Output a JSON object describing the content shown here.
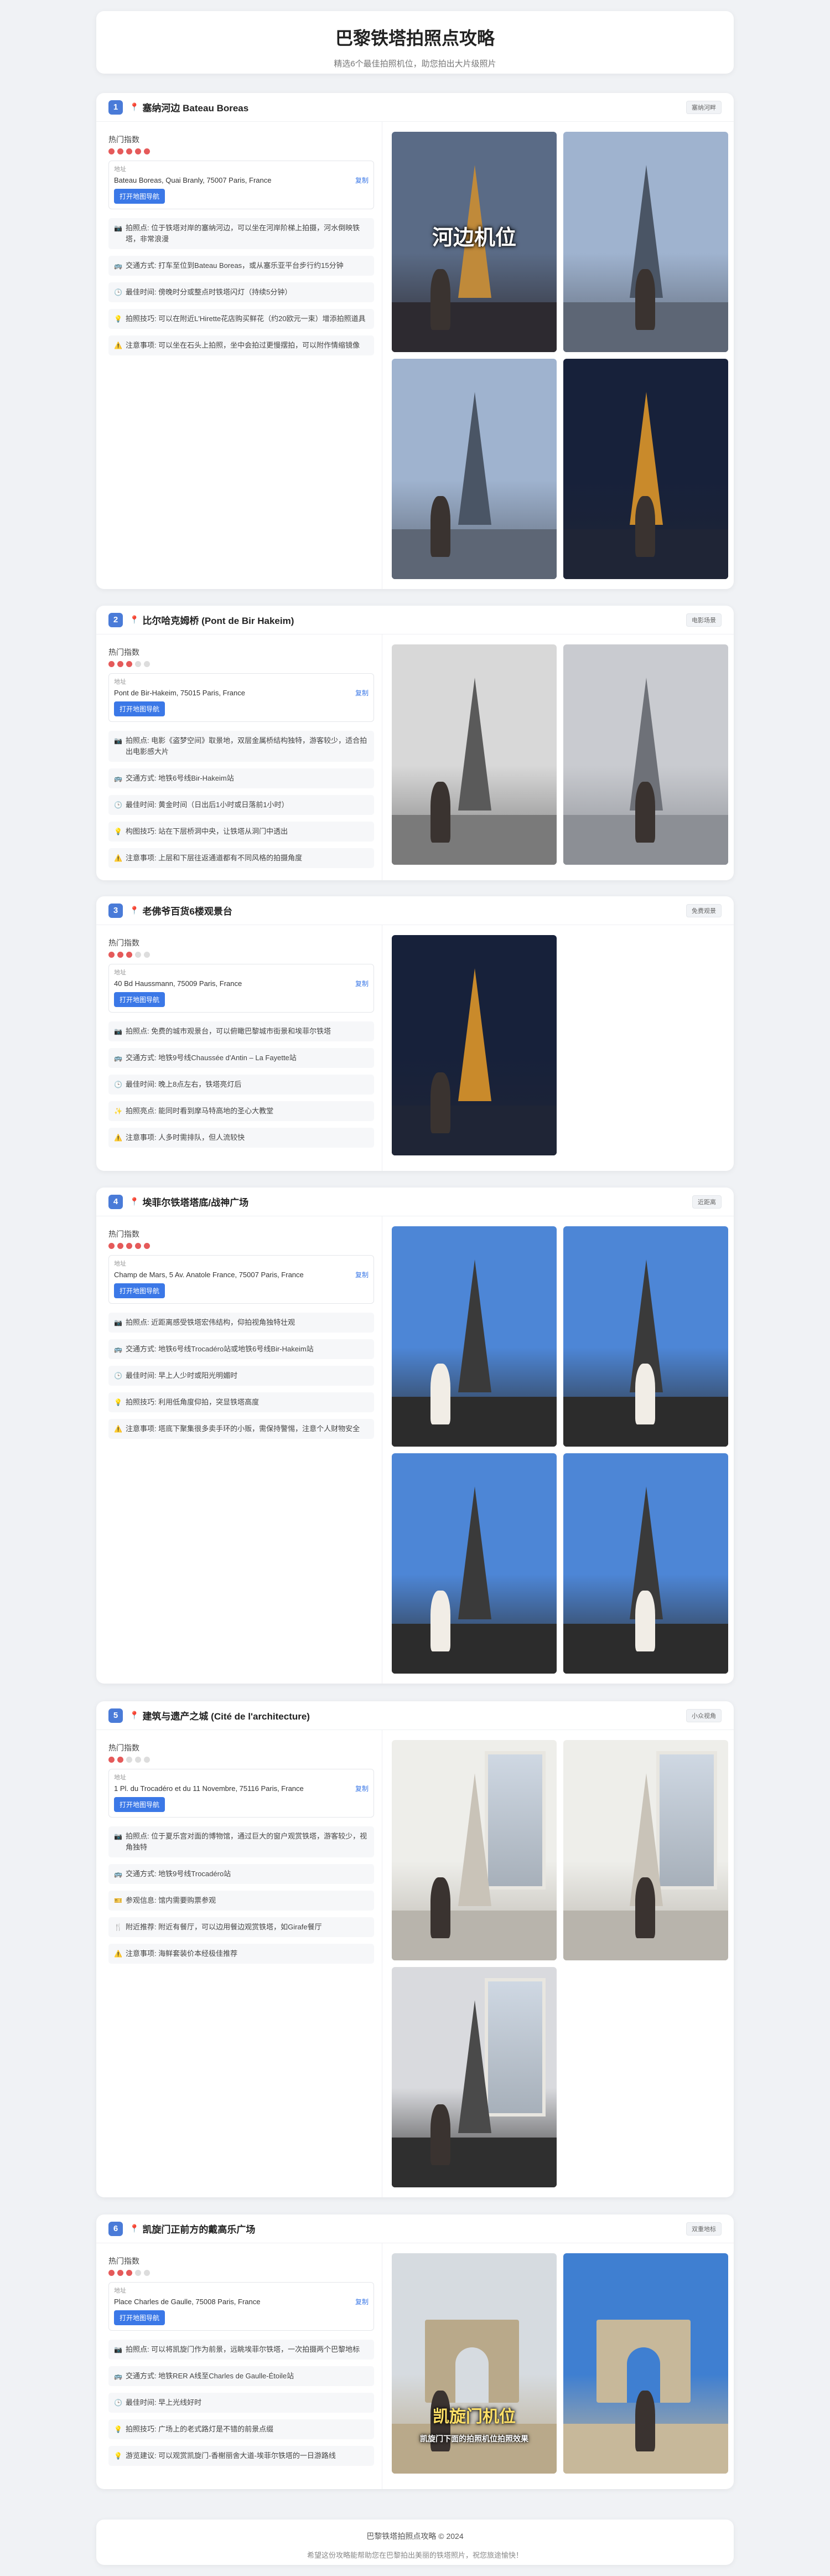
{
  "header": {
    "title": "巴黎铁塔拍照点攻略",
    "subtitle": "精选6个最佳拍照机位，助您拍出大片级照片"
  },
  "common": {
    "popularity_label": "热门指数",
    "address_label": "地址",
    "copy_label": "复制",
    "nav_label": "打开地图导航"
  },
  "sections": [
    {
      "num": "1",
      "title": "塞纳河边 Bateau Boreas",
      "tag": "塞纳河畔",
      "rating": 5,
      "address": "Bateau Boreas, Quai Branly, 75007 Paris, France",
      "tips": [
        {
          "icon": "camera-icon",
          "text": "拍照点: 位于铁塔对岸的塞纳河边，可以坐在河岸阶梯上拍摄，河水倒映铁塔，非常浪漫"
        },
        {
          "icon": "bus-icon",
          "text": "交通方式: 打车至位到Bateau Boreas，或从塞乐亚平台步行约15分钟"
        },
        {
          "icon": "clock-icon",
          "text": "最佳时间: 傍晚时分或整点时铁塔闪灯（持续5分钟）"
        },
        {
          "icon": "bulb-icon",
          "text": "拍照技巧: 可以在附近L'Hirette花店购买鲜花（约20欧元一束）增添拍照道具"
        },
        {
          "icon": "warning-icon",
          "text": "注意事项: 可以坐在石头上拍照，坐中会拍过更慢摆拍，可以附作情缩镜像"
        }
      ],
      "photo_caption": "河边机位"
    },
    {
      "num": "2",
      "title": "比尔哈克姆桥 (Pont de Bir Hakeim)",
      "tag": "电影场景",
      "rating": 3,
      "address": "Pont de Bir-Hakeim, 75015 Paris, France",
      "tips": [
        {
          "icon": "camera-icon",
          "text": "拍照点: 电影《盗梦空间》取景地，双层金属桥结构独特，游客较少，适合拍出电影感大片"
        },
        {
          "icon": "bus-icon",
          "text": "交通方式: 地铁6号线Bir-Hakeim站"
        },
        {
          "icon": "clock-icon",
          "text": "最佳时间: 黄金时间（日出后1小时或日落前1小时）"
        },
        {
          "icon": "bulb-icon",
          "text": "构图技巧: 站在下层桥洞中央，让铁塔从洞门中透出"
        },
        {
          "icon": "warning-icon",
          "text": "注意事项: 上层和下层往返通道都有不同风格的拍摄角度"
        }
      ]
    },
    {
      "num": "3",
      "title": "老佛爷百货6楼观景台",
      "tag": "免费观景",
      "rating": 3,
      "address": "40 Bd Haussmann, 75009 Paris, France",
      "tips": [
        {
          "icon": "camera-icon",
          "text": "拍照点: 免费的城市观景台，可以俯瞰巴黎城市街景和埃菲尔铁塔"
        },
        {
          "icon": "bus-icon",
          "text": "交通方式: 地铁9号线Chaussée d'Antin – La Fayette站"
        },
        {
          "icon": "clock-icon",
          "text": "最佳时间: 晚上8点左右，铁塔亮灯后"
        },
        {
          "icon": "sparkle-icon",
          "text": "拍照亮点: 能同时看到摩马特高地的圣心大教堂"
        },
        {
          "icon": "warning-icon",
          "text": "注意事项: 人多时需排队，但人流较快"
        }
      ]
    },
    {
      "num": "4",
      "title": "埃菲尔铁塔塔底/战神广场",
      "tag": "近距离",
      "rating": 5,
      "address": "Champ de Mars, 5 Av. Anatole France, 75007 Paris, France",
      "tips": [
        {
          "icon": "camera-icon",
          "text": "拍照点: 近距离感受铁塔宏伟结构，仰拍视角独特壮观"
        },
        {
          "icon": "bus-icon",
          "text": "交通方式: 地铁6号线Trocadéro站或地铁6号线Bir-Hakeim站"
        },
        {
          "icon": "clock-icon",
          "text": "最佳时间: 早上人少时或阳光明媚时"
        },
        {
          "icon": "bulb-icon",
          "text": "拍照技巧: 利用低角度仰拍，突显铁塔高度"
        },
        {
          "icon": "warning-icon",
          "text": "注意事项: 塔底下聚集很多卖手环的小贩，需保持警惕，注意个人财物安全"
        }
      ]
    },
    {
      "num": "5",
      "title": "建筑与遗产之城 (Cité de l'architecture)",
      "tag": "小众视角",
      "rating": 2,
      "address": "1 Pl. du Trocadéro et du 11 Novembre, 75116 Paris, France",
      "tips": [
        {
          "icon": "camera-icon",
          "text": "拍照点: 位于夏乐宫对面的博物馆，通过巨大的窗户观赏铁塔，游客较少，视角独特"
        },
        {
          "icon": "bus-icon",
          "text": "交通方式: 地铁9号线Trocadéro站"
        },
        {
          "icon": "ticket-icon",
          "text": "参观信息: 馆内需要购票参观"
        },
        {
          "icon": "fork-icon",
          "text": "附近推荐: 附近有餐厅，可以边用餐边观赏铁塔，如Girafe餐厅"
        },
        {
          "icon": "warning-icon",
          "text": "注意事项: 海鲜套装价本经极佳推荐"
        }
      ]
    },
    {
      "num": "6",
      "title": "凯旋门正前方的戴高乐广场",
      "tag": "双重地标",
      "rating": 3,
      "address": "Place Charles de Gaulle, 75008 Paris, France",
      "tips": [
        {
          "icon": "camera-icon",
          "text": "拍照点: 可以将凯旋门作为前景，远眺埃菲尔铁塔，一次拍摄两个巴黎地标"
        },
        {
          "icon": "bus-icon",
          "text": "交通方式: 地铁RER A线至Charles de Gaulle-Étoile站"
        },
        {
          "icon": "clock-icon",
          "text": "最佳时间: 早上光线好时"
        },
        {
          "icon": "bulb-icon",
          "text": "拍照技巧: 广场上的老式路灯是不错的前景点缀"
        },
        {
          "icon": "bulb-icon",
          "text": "游览建议: 可以观赏凯旋门-香榭丽舍大道-埃菲尔铁塔的一日游路线"
        }
      ],
      "photo_caption": "凯旋门机位",
      "photo_caption2": "凯旋门下面的拍照机位拍照效果"
    }
  ],
  "footer": {
    "line1": "巴黎铁塔拍照点攻略 © 2024",
    "line2": "希望这份攻略能帮助您在巴黎拍出美丽的铁塔照片，祝您旅途愉快！"
  },
  "colors": {
    "accent": "#3b78e7",
    "badge": "#4a7bd8",
    "star_on": "#e55a5a",
    "star_off": "#dddddd",
    "page_bg": "#f0f2f5"
  }
}
